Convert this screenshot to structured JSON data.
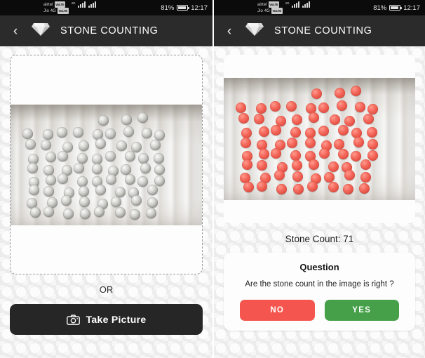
{
  "statusbar": {
    "carrier1": "airtel",
    "carrier1_badge": "VoLTE",
    "carrier2": "Jio 4G",
    "carrier2_badge": "VoLTE",
    "network_sup": "4G",
    "battery": "81%",
    "time": "12:17"
  },
  "appbar": {
    "back_label": "‹",
    "logo_name": "diamond-icon",
    "title": "STONE COUNTING"
  },
  "left_panel": {
    "drop_area_name": "image-drop-area",
    "or_label": "OR",
    "take_picture_label": "Take Picture",
    "camera_icon": "camera-icon"
  },
  "right_panel": {
    "result_image_name": "detected-stones-image",
    "count_label": "Stone Count: 71",
    "count_value": 71,
    "question": {
      "title": "Question",
      "text": "Are the stone count in the image is right ?",
      "no_label": "NO",
      "yes_label": "YES"
    }
  },
  "colors": {
    "appbar_bg": "#2b2b2b",
    "statusbar_bg": "#0b0b0b",
    "page_bg": "#ececec",
    "card_bg": "#fdfdfd",
    "button_dark": "#262626",
    "no_red": "#f4564f",
    "yes_green": "#45a049",
    "dashed_border": "#9a9a9a"
  }
}
